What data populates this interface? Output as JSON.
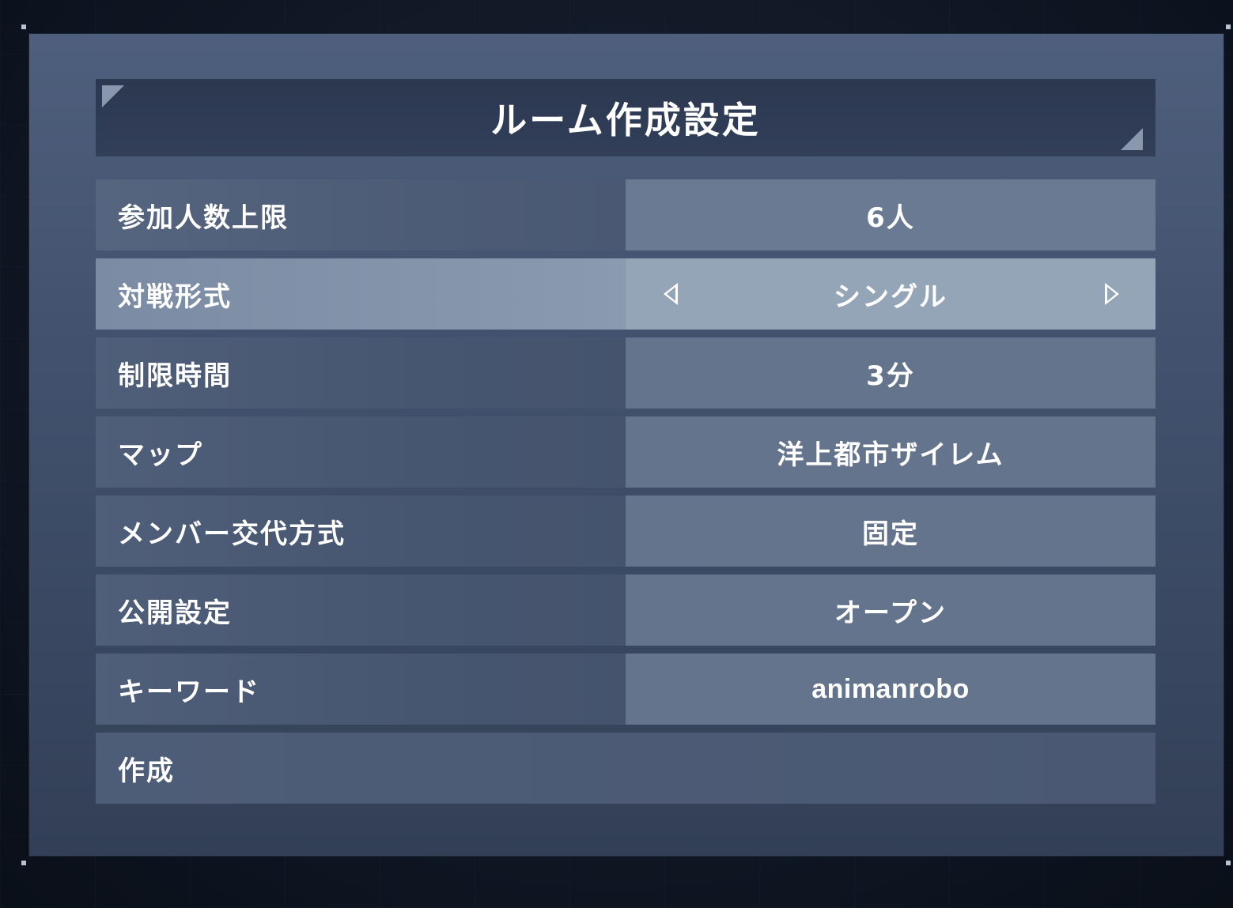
{
  "window": {
    "title": "ルーム作成設定"
  },
  "settings": [
    {
      "label": "参加人数上限",
      "value": "6人"
    },
    {
      "label": "対戦形式",
      "value": "シングル",
      "selected": true
    },
    {
      "label": "制限時間",
      "value": "3分"
    },
    {
      "label": "マップ",
      "value": "洋上都市ザイレム"
    },
    {
      "label": "メンバー交代方式",
      "value": "固定"
    },
    {
      "label": "公開設定",
      "value": "オープン"
    },
    {
      "label": "キーワード",
      "value": "animanrobo"
    }
  ],
  "create": {
    "label": "作成"
  },
  "icons": {
    "prev": "triangle-left-icon",
    "next": "triangle-right-icon"
  },
  "colors": {
    "panel": "#43536f",
    "selected_row": "#95a5b8",
    "text": "#ffffff"
  }
}
